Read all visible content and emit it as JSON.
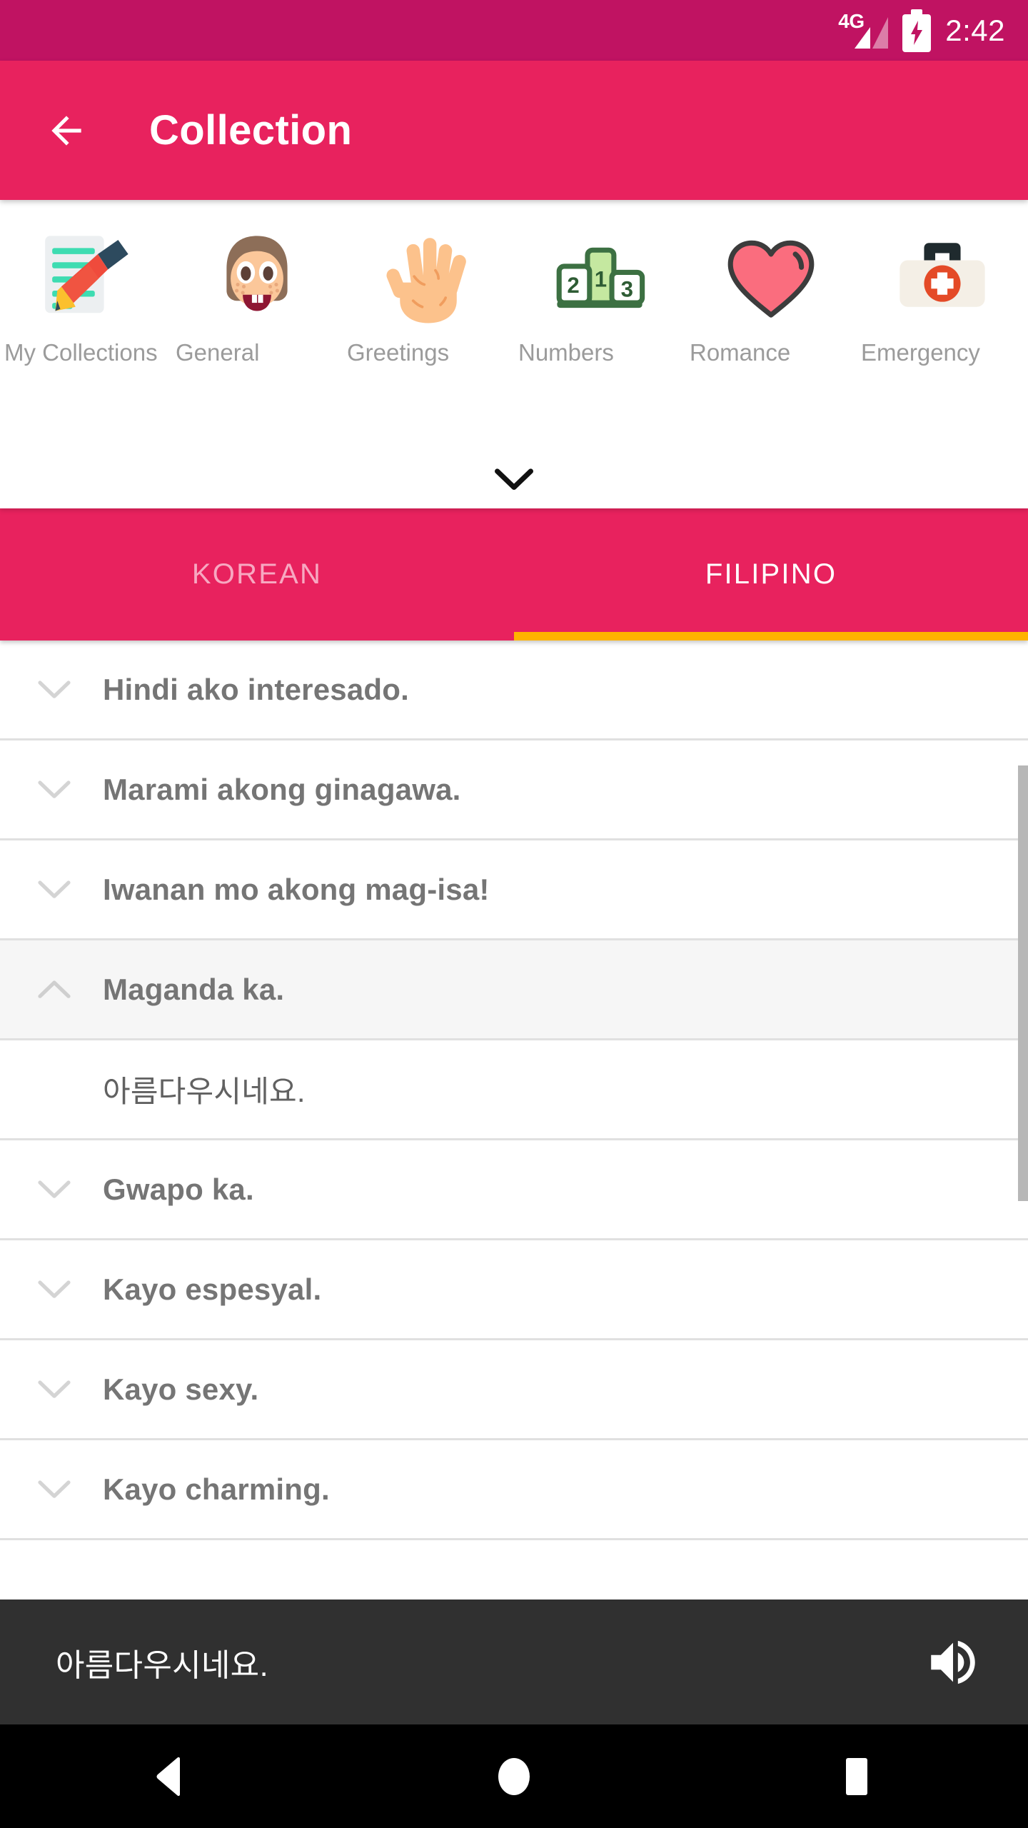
{
  "status_bar": {
    "network_label": "4G",
    "time": "2:42",
    "signal_icon": "signal-4g-icon",
    "battery_icon": "battery-charging-icon",
    "bg_color": "#c01362"
  },
  "app_bar": {
    "title": "Collection",
    "back_icon": "arrow-left-icon",
    "bg_color": "#e8225e"
  },
  "categories": {
    "items": [
      {
        "label": "My Collections",
        "icon": "memo-pencil-icon"
      },
      {
        "label": "General",
        "icon": "girl-face-icon"
      },
      {
        "label": "Greetings",
        "icon": "raised-hand-icon"
      },
      {
        "label": "Numbers",
        "icon": "podium-123-icon"
      },
      {
        "label": "Romance",
        "icon": "heart-icon"
      },
      {
        "label": "Emergency",
        "icon": "first-aid-kit-icon"
      }
    ],
    "expand_icon": "chevron-down-icon"
  },
  "tabs": {
    "items": [
      {
        "label": "KOREAN",
        "active": false
      },
      {
        "label": "FILIPINO",
        "active": true
      }
    ],
    "indicator_color": "#ffb300"
  },
  "phrase_list": {
    "rows": [
      {
        "text": "Hindi ako interesado.",
        "expanded": false,
        "chevron": "chevron-down-icon"
      },
      {
        "text": "Marami akong ginagawa.",
        "expanded": false,
        "chevron": "chevron-down-icon"
      },
      {
        "text": "Iwanan mo akong mag-isa!",
        "expanded": false,
        "chevron": "chevron-down-icon"
      },
      {
        "text": "Maganda ka.",
        "expanded": true,
        "chevron": "chevron-up-icon",
        "translation": "아름다우시네요."
      },
      {
        "text": "Gwapo ka.",
        "expanded": false,
        "chevron": "chevron-down-icon"
      },
      {
        "text": "Kayo espesyal.",
        "expanded": false,
        "chevron": "chevron-down-icon"
      },
      {
        "text": "Kayo sexy.",
        "expanded": false,
        "chevron": "chevron-down-icon"
      },
      {
        "text": "Kayo charming.",
        "expanded": false,
        "chevron": "chevron-down-icon"
      }
    ]
  },
  "audio_bar": {
    "text": "아름다우시네요.",
    "speaker_icon": "volume-up-icon",
    "bg_color": "#303030"
  },
  "nav_bar": {
    "back_icon": "nav-back-triangle-icon",
    "home_icon": "nav-home-circle-icon",
    "recents_icon": "nav-recents-square-icon"
  }
}
